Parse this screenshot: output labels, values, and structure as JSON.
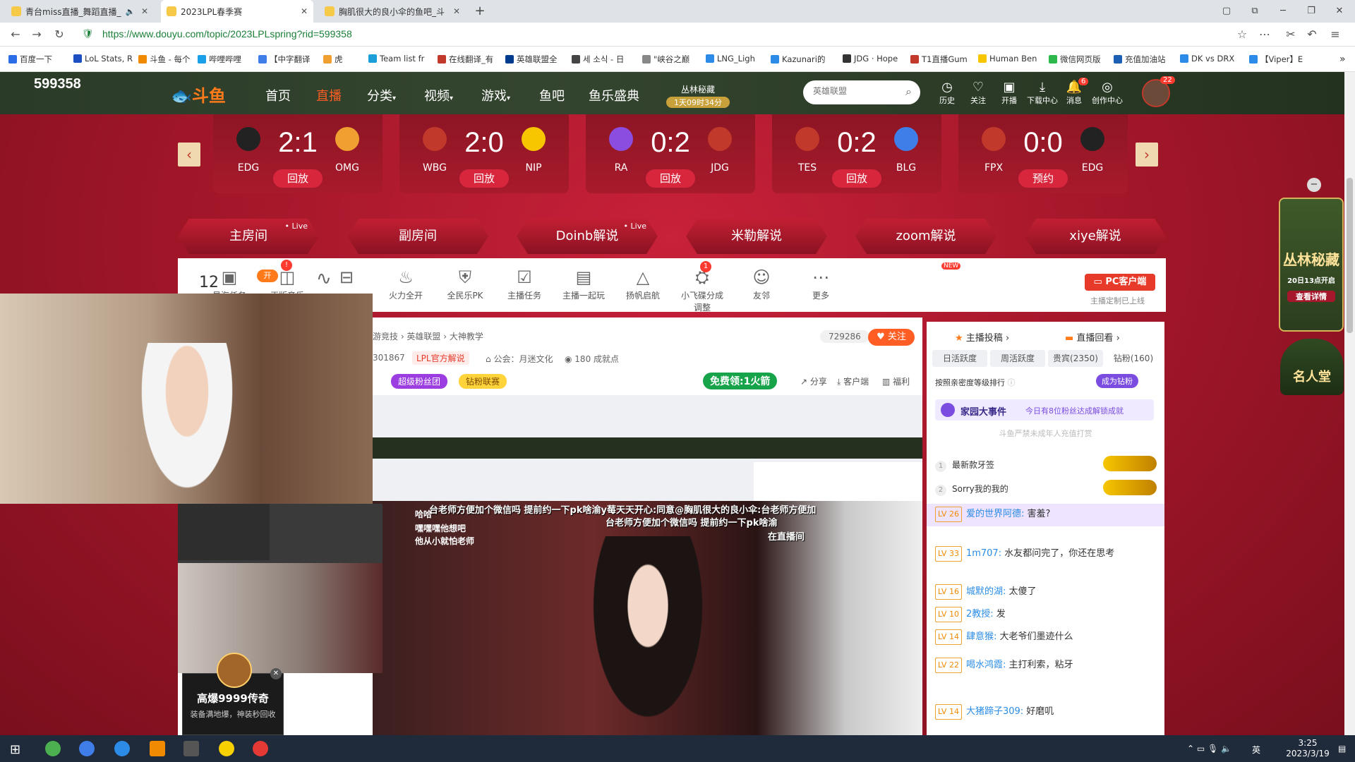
{
  "browser": {
    "tabs": [
      {
        "title": "青台miss直播_舞蹈直播_"
      },
      {
        "title": "2023LPL春季赛"
      },
      {
        "title": "胸肌很大的良小伞的鱼吧_斗"
      }
    ],
    "url": "https://www.douyu.com/topic/2023LPLspring?rid=599358",
    "bookmarks": [
      "百度一下",
      "LoL Stats, R",
      "斗鱼 - 每个",
      "哔哩哔哩",
      "【中字翻译",
      "虎",
      "Team list fr",
      "在线翻译_有",
      "英雄联盟全",
      "세 소식 - 日",
      "\"峡谷之巅",
      "LNG_Ligh",
      "Kazunari的",
      "JDG · Hope",
      "T1直播Gum",
      "Human Ben",
      "微信网页版",
      "充值加油站",
      "DK vs DRX",
      "【Viper】E"
    ]
  },
  "site": {
    "room_label": "599358",
    "brand": "斗鱼",
    "nav": [
      "首页",
      "直播",
      "分类",
      "视频",
      "游戏",
      "鱼吧",
      "鱼乐盛典"
    ],
    "promo_title": "丛林秘藏",
    "promo_timer": "1天09时34分",
    "search_placeholder": "英雄联盟",
    "header_icons": [
      "历史",
      "关注",
      "开播",
      "下载中心",
      "消息",
      "创作中心"
    ],
    "message_badge": "6",
    "avatar_badge": "22"
  },
  "matches": [
    {
      "team1": "EDG",
      "score": "2:1",
      "team2": "OMG",
      "action": "回放"
    },
    {
      "team1": "WBG",
      "score": "2:0",
      "team2": "NIP",
      "action": "回放"
    },
    {
      "team1": "RA",
      "score": "0:2",
      "team2": "JDG",
      "action": "回放"
    },
    {
      "team1": "TES",
      "score": "0:2",
      "team2": "BLG",
      "action": "回放"
    },
    {
      "team1": "FPX",
      "score": "0:0",
      "team2": "EDG",
      "action": "预约"
    }
  ],
  "room_tabs": [
    {
      "label": "主房间",
      "live": "• Live"
    },
    {
      "label": "副房间",
      "live": ""
    },
    {
      "label": "Doinb解说",
      "live": "• Live"
    },
    {
      "label": "米勒解说",
      "live": ""
    },
    {
      "label": "zoom解说",
      "live": ""
    },
    {
      "label": "xiye解说",
      "live": ""
    }
  ],
  "toolbar": {
    "count": "12",
    "badge_open": "开",
    "badge_1": "!",
    "tools": [
      "星海任务",
      "正版音乐",
      "",
      "火力全开",
      "全民乐PK",
      "主播任务",
      "主播一起玩",
      "扬帆启航",
      "小飞碟分成调整",
      "友邻",
      "更多"
    ],
    "task_badge": "1",
    "new_badge": "NEW",
    "pc_client": "PC客户端",
    "pc_note": "主播定制已上线"
  },
  "stream": {
    "breadcrumb": "游竞技 › 英雄联盟 › 大神教学",
    "room_id": "301867",
    "official": "LPL官方解说",
    "guild": "公会：月迷文化",
    "achievements": "180 成就点",
    "viewers": "729286",
    "follow": "关注",
    "fan_group": "超级粉丝团",
    "diamond": "钻粉联赛",
    "free_rocket": "免费领:1火箭",
    "share": "分享",
    "client": "客户端",
    "welfare": "福利",
    "danmaku1": "台老师方便加个微信吗 提前约一下pk啥渝y莓天天开心:同意@胸肌很大的良小伞:台老师方便加",
    "danmaku2": "台老师方便加个微信吗 提前约一下pk啥渝",
    "danmaku3": "在直播间",
    "overlay1": "哈哈",
    "overlay2": "嘿嘿嘿他想吧",
    "overlay3": "他从小就怕老师",
    "ad_title": "高爆9999传奇",
    "ad_sub": "装备满地爆，神装秒回收"
  },
  "chat": {
    "tab_contribute": "主播投稿",
    "tab_replay": "直播回看",
    "rank_tabs": [
      "日活跃度",
      "周活跃度",
      "贵宾(2350)",
      "钻粉(160)"
    ],
    "rank_note": "按照亲密度等级排行",
    "become_diamond": "成为钻粉",
    "event_title": "家园大事件",
    "event_text": "今日有8位粉丝达成解锁成就",
    "notice": "斗鱼严禁未成年人充值打赏",
    "rank": [
      {
        "n": "1",
        "name": "最新款牙签"
      },
      {
        "n": "2",
        "name": "Sorry我的我的"
      }
    ],
    "messages": [
      {
        "lv": "LV 26",
        "user": "爱的世界阿德:",
        "text": "害羞?"
      },
      {
        "lv": "LV 33",
        "user": "1m707:",
        "text": "水友都问完了，你还在思考"
      },
      {
        "lv": "LV 16",
        "user": "城默的湖:",
        "text": "太傻了"
      },
      {
        "lv": "LV 10",
        "user": "2教授:",
        "text": "发"
      },
      {
        "lv": "LV 14",
        "user": "肆意猴:",
        "text": "大老爷们墨迹什么"
      },
      {
        "lv": "LV 22",
        "user": "喝水鸿霞:",
        "text": "主打利索，粘牙"
      },
      {
        "lv": "LV 14",
        "user": "大猪蹄子309:",
        "text": "好磨叽"
      }
    ]
  },
  "side_banner": {
    "title1": "丛林秘藏",
    "date": "20日13点开启",
    "btn": "查看详情",
    "title2": "名人堂"
  },
  "taskbar": {
    "time": "3:25",
    "date": "2023/3/19",
    "ime": "英"
  }
}
